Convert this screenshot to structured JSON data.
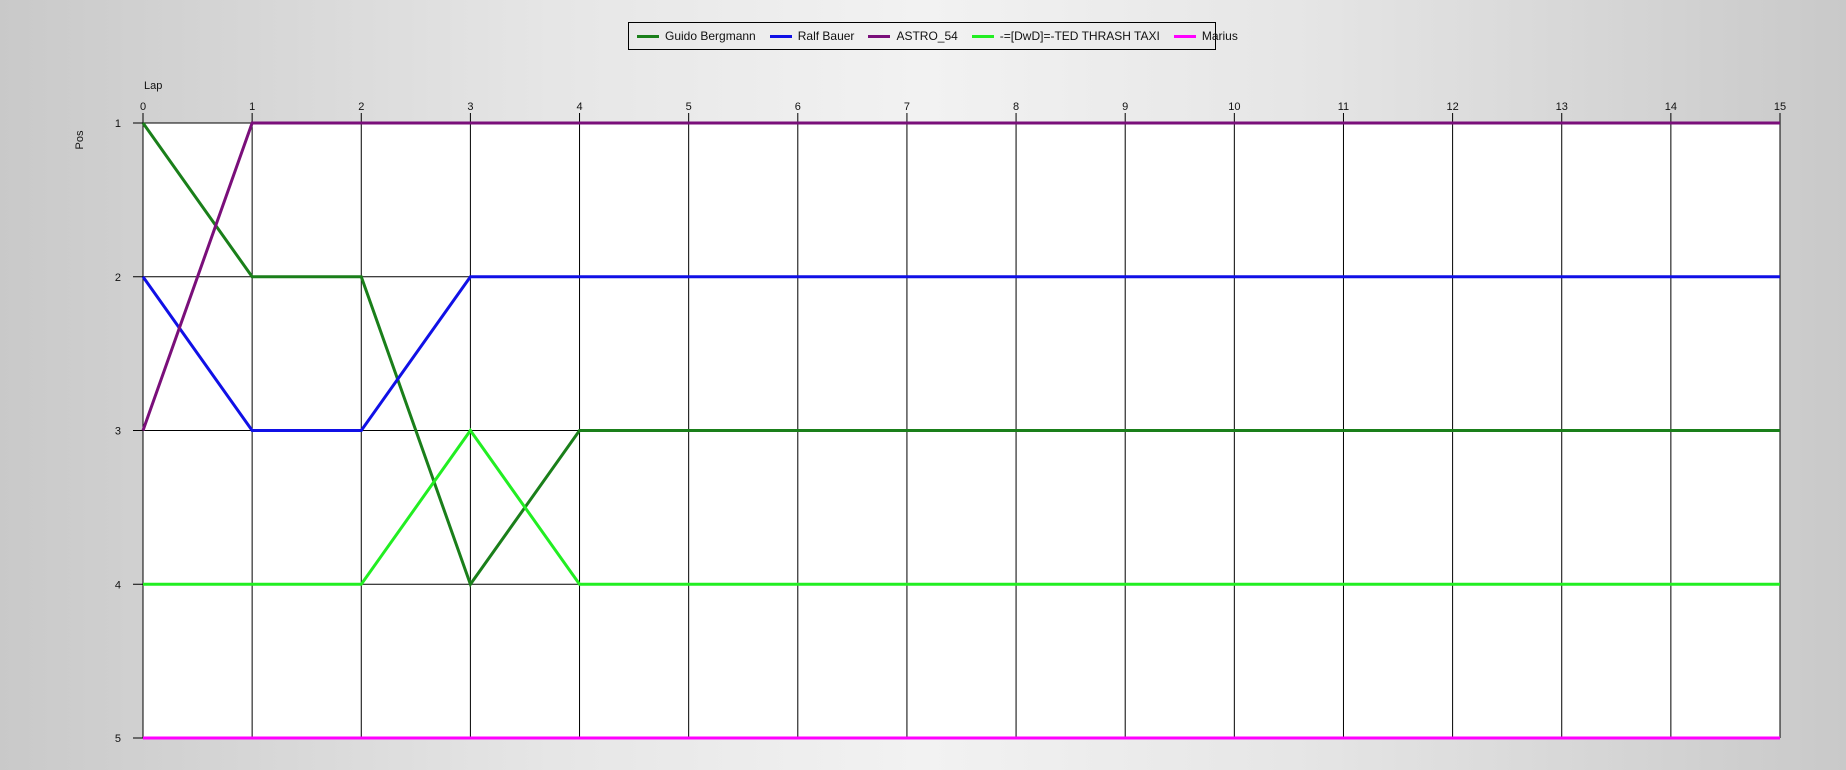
{
  "chart_data": {
    "type": "line",
    "xlabel": "Lap",
    "ylabel": "Pos",
    "x": [
      0,
      1,
      2,
      3,
      4,
      5,
      6,
      7,
      8,
      9,
      10,
      11,
      12,
      13,
      14,
      15
    ],
    "ylim": [
      1,
      5
    ],
    "y_reversed": true,
    "y_ticks": [
      1,
      2,
      3,
      4,
      5
    ],
    "grid": true,
    "legend_position": "top-center",
    "series": [
      {
        "name": "Guido Bergmann",
        "color": "#1a7f1a",
        "values": [
          1,
          2,
          2,
          4,
          3,
          3,
          3,
          3,
          3,
          3,
          3,
          3,
          3,
          3,
          3,
          3
        ]
      },
      {
        "name": "Ralf Bauer",
        "color": "#1010e6",
        "values": [
          2,
          3,
          3,
          2,
          2,
          2,
          2,
          2,
          2,
          2,
          2,
          2,
          2,
          2,
          2,
          2
        ]
      },
      {
        "name": "ASTRO_54",
        "color": "#7a0f7a",
        "values": [
          3,
          1,
          1,
          1,
          1,
          1,
          1,
          1,
          1,
          1,
          1,
          1,
          1,
          1,
          1,
          1
        ]
      },
      {
        "name": "-=[DwD]=-TED THRASH TAXI",
        "color": "#22ee22",
        "values": [
          4,
          4,
          4,
          3,
          4,
          4,
          4,
          4,
          4,
          4,
          4,
          4,
          4,
          4,
          4,
          4
        ]
      },
      {
        "name": "Marius",
        "color": "#ff00ff",
        "values": [
          5,
          5,
          5,
          5,
          5,
          5,
          5,
          5,
          5,
          5,
          5,
          5,
          5,
          5,
          5,
          5
        ]
      }
    ]
  }
}
